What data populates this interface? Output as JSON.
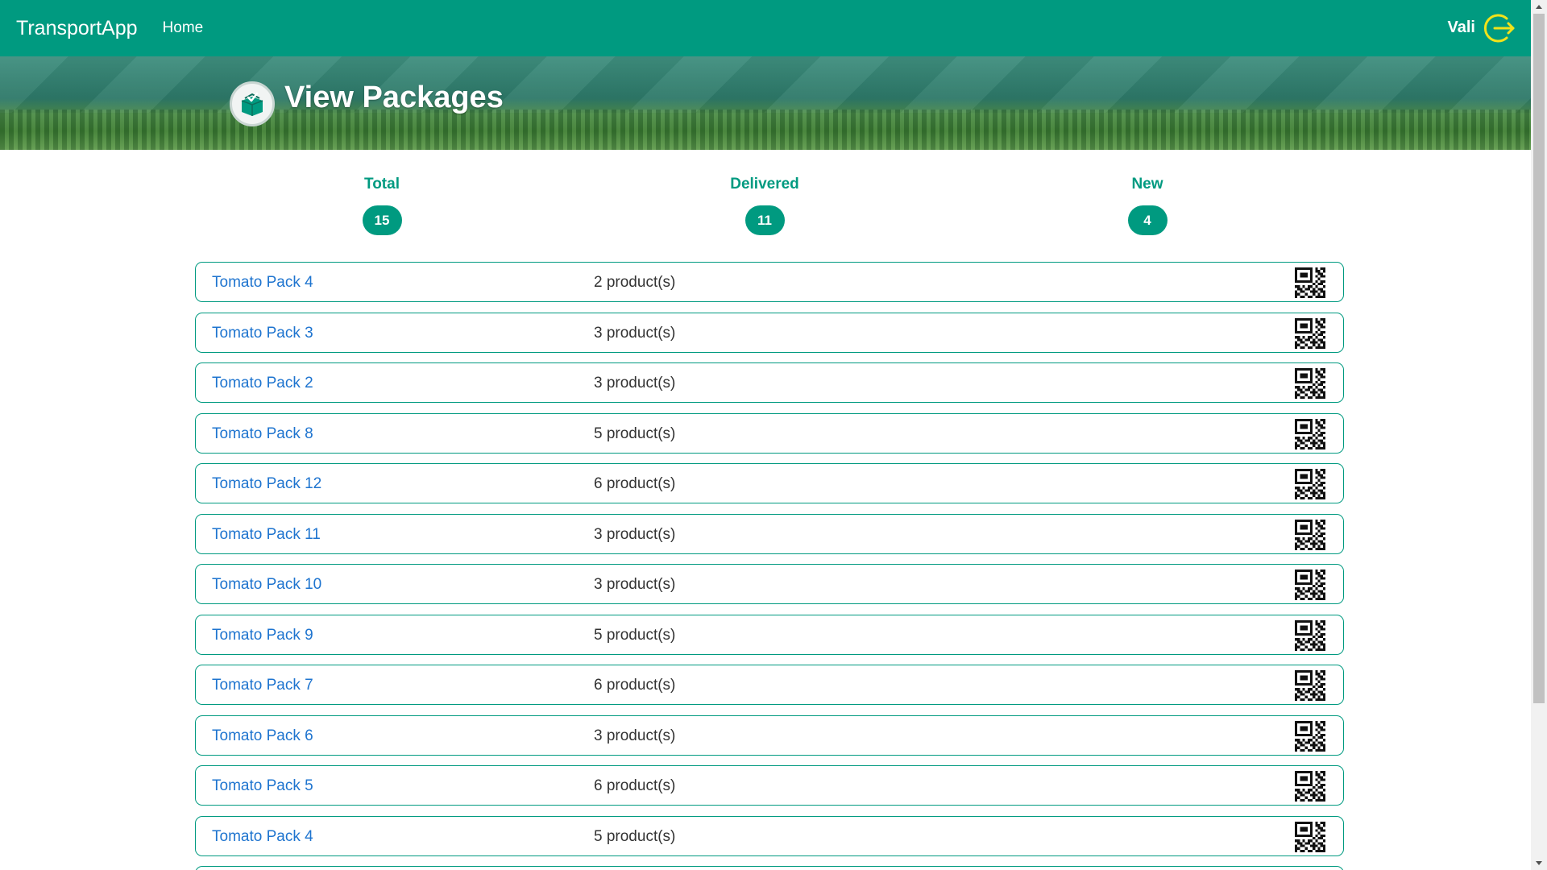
{
  "navbar": {
    "brand": "TransportApp",
    "home_label": "Home",
    "user_name": "Vali",
    "logout_icon": "logout-icon"
  },
  "header": {
    "title": "View Packages",
    "logo_icon": "package-check-icon"
  },
  "stats": {
    "total_label": "Total",
    "total_value": "15",
    "delivered_label": "Delivered",
    "delivered_value": "11",
    "new_label": "New",
    "new_value": "4"
  },
  "packages": [
    {
      "name": "Tomato Pack 4",
      "products": "2 product(s)"
    },
    {
      "name": "Tomato Pack 3",
      "products": "3 product(s)"
    },
    {
      "name": "Tomato Pack 2",
      "products": "3 product(s)"
    },
    {
      "name": "Tomato Pack 8",
      "products": "5 product(s)"
    },
    {
      "name": "Tomato Pack 12",
      "products": "6 product(s)"
    },
    {
      "name": "Tomato Pack 11",
      "products": "3 product(s)"
    },
    {
      "name": "Tomato Pack 10",
      "products": "3 product(s)"
    },
    {
      "name": "Tomato Pack 9",
      "products": "5 product(s)"
    },
    {
      "name": "Tomato Pack 7",
      "products": "6 product(s)"
    },
    {
      "name": "Tomato Pack 6",
      "products": "3 product(s)"
    },
    {
      "name": "Tomato Pack 5",
      "products": "6 product(s)"
    },
    {
      "name": "Tomato Pack 4",
      "products": "5 product(s)"
    }
  ],
  "colors": {
    "primary": "#009a80",
    "link": "#1e74cf",
    "logout_accent": "#f2e21a"
  }
}
